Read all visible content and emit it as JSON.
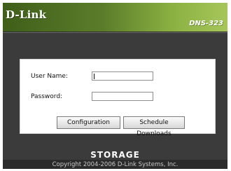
{
  "brand": {
    "logo_text": "D-Link",
    "model": "DNS-323"
  },
  "login": {
    "username_label": "User Name:",
    "password_label": "Password:",
    "username_value": "",
    "password_value": "",
    "configuration_button": "Configuration",
    "schedule_button": "Schedule Downloads"
  },
  "footer": {
    "title": "STORAGE",
    "copyright": "Copyright 2004-2006 D-Link Systems, Inc."
  },
  "colors": {
    "background": "#3b3b3b",
    "header_green_dark": "#3f5f1a",
    "header_green_light": "#a6c65a",
    "panel": "#ffffff"
  }
}
